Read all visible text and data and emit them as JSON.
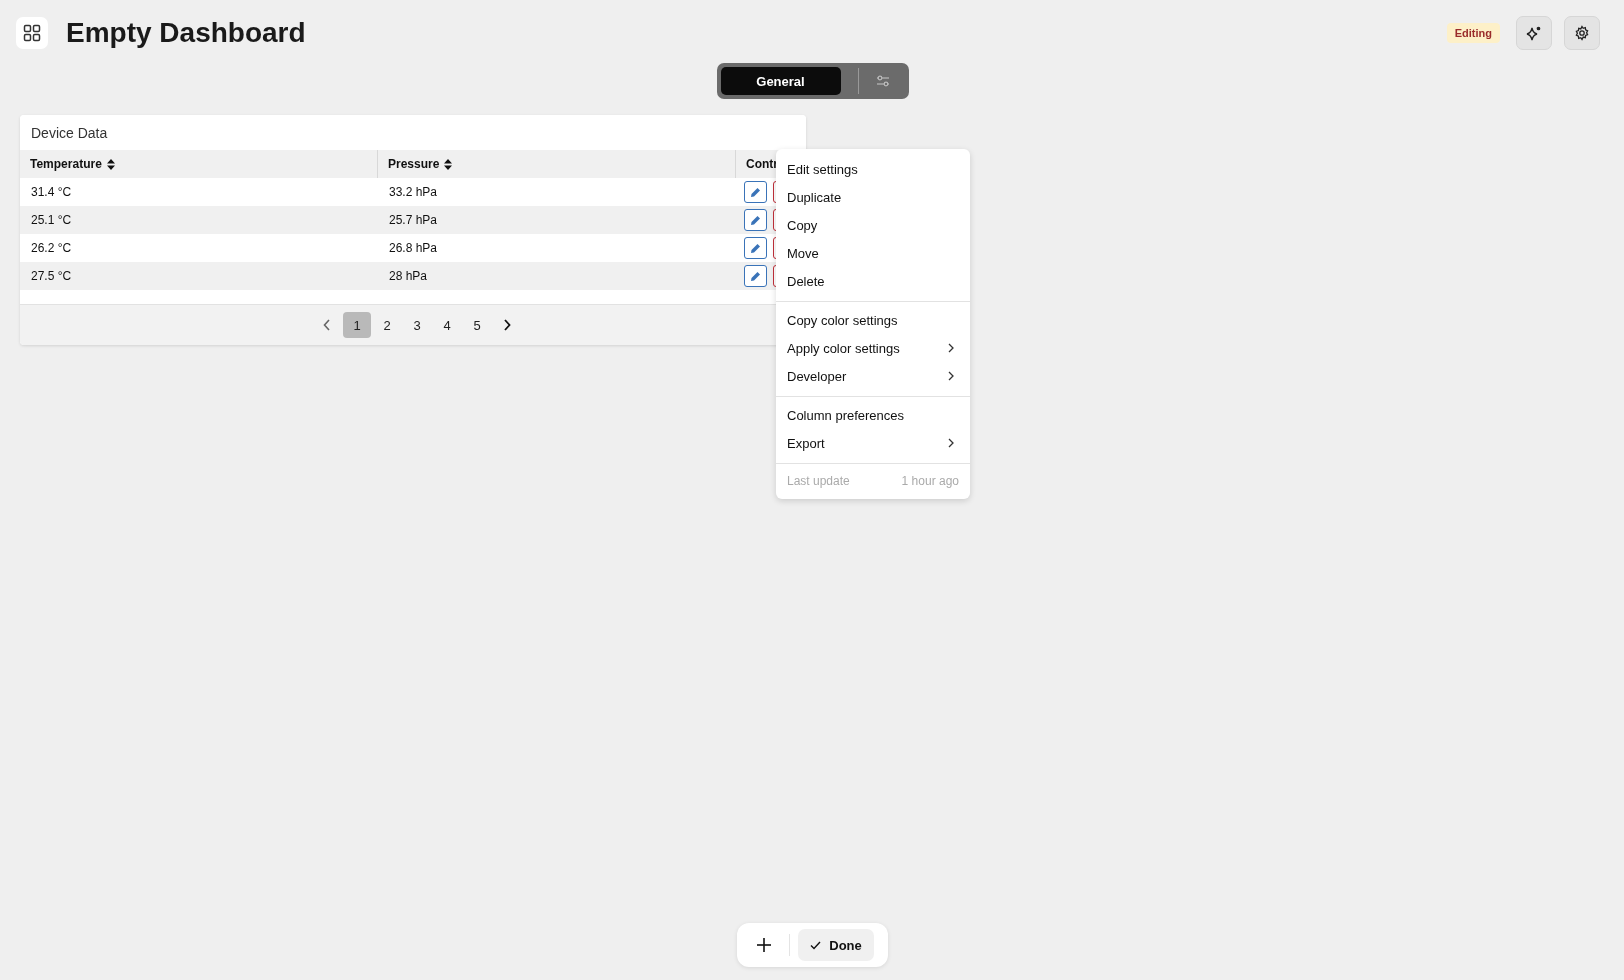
{
  "header": {
    "title": "Empty Dashboard",
    "status_badge": "Editing"
  },
  "tabs": [
    {
      "label": "General",
      "selected": true
    }
  ],
  "widget": {
    "title": "Device Data",
    "columns": [
      {
        "label": "Temperature",
        "sortable": true
      },
      {
        "label": "Pressure",
        "sortable": true
      },
      {
        "label": "Contr"
      }
    ],
    "rows": [
      [
        "31.4 °C",
        "33.2 hPa"
      ],
      [
        "25.1 °C",
        "25.7 hPa"
      ],
      [
        "26.2 °C",
        "26.8 hPa"
      ],
      [
        "27.5 °C",
        "28 hPa"
      ]
    ],
    "pages": [
      {
        "label": "1",
        "selected": true
      },
      {
        "label": "2",
        "selected": false
      },
      {
        "label": "3",
        "selected": false
      },
      {
        "label": "4",
        "selected": false
      },
      {
        "label": "5",
        "selected": false
      }
    ]
  },
  "context_menu": {
    "sections": [
      [
        {
          "label": "Edit settings",
          "submenu": false
        },
        {
          "label": "Duplicate",
          "submenu": false
        },
        {
          "label": "Copy",
          "submenu": false
        },
        {
          "label": "Move",
          "submenu": false
        },
        {
          "label": "Delete",
          "submenu": false
        }
      ],
      [
        {
          "label": "Copy color settings",
          "submenu": false
        },
        {
          "label": "Apply color settings",
          "submenu": true
        },
        {
          "label": "Developer",
          "submenu": true
        }
      ],
      [
        {
          "label": "Column preferences",
          "submenu": false
        },
        {
          "label": "Export",
          "submenu": true
        }
      ]
    ],
    "footer": {
      "label": "Last update",
      "value": "1 hour ago"
    }
  },
  "bottom_bar": {
    "done_label": "Done"
  }
}
